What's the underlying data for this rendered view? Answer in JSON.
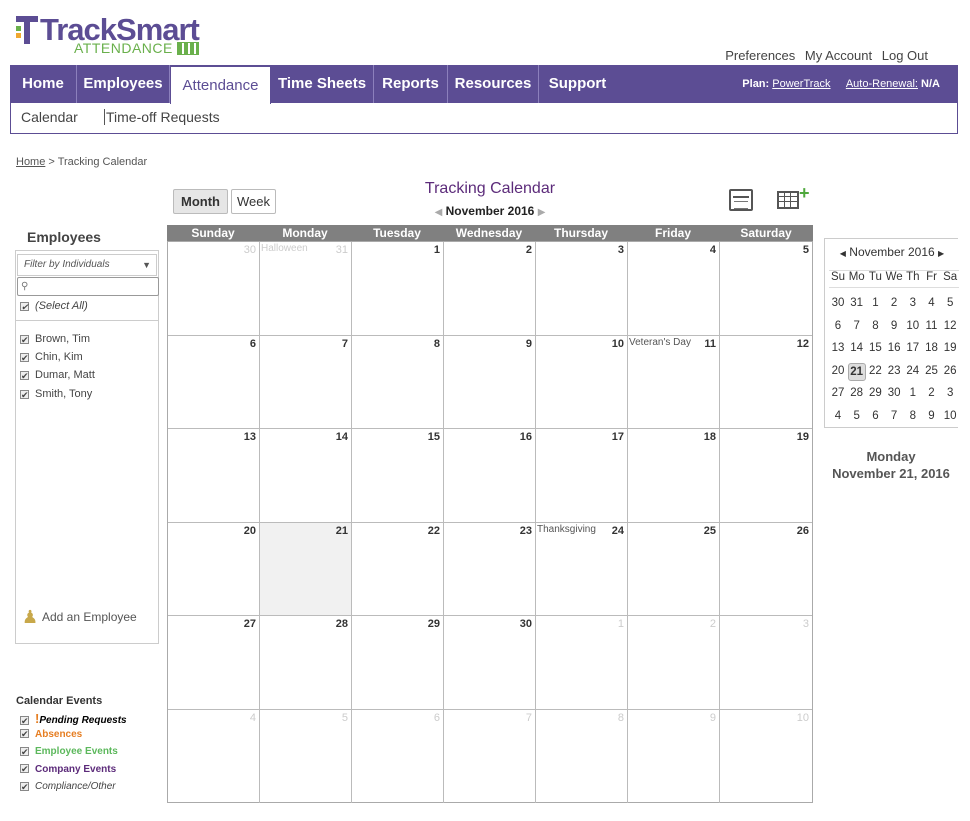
{
  "brand": {
    "name_main": "TrackSmart",
    "name_sub": "ATTENDANCE"
  },
  "toplinks": [
    "Preferences",
    "My Account",
    "Log Out"
  ],
  "nav": [
    "Home",
    "Employees",
    "Attendance",
    "Time Sheets",
    "Reports",
    "Resources",
    "Support"
  ],
  "plan": {
    "plan_label": "Plan:",
    "plan_value": "PowerTrack",
    "renewal_label": "Auto-Renewal:",
    "renewal_value": "N/A"
  },
  "subnav": [
    "Calendar",
    "Time-off Requests"
  ],
  "breadcrumb": {
    "home": "Home",
    "sep": " > ",
    "current": "Tracking Calendar"
  },
  "view_buttons": {
    "month": "Month",
    "week": "Week"
  },
  "calendar": {
    "title": "Tracking Calendar",
    "month_label": "November 2016",
    "weekdays": [
      "Sunday",
      "Monday",
      "Tuesday",
      "Wednesday",
      "Thursday",
      "Friday",
      "Saturday"
    ],
    "weeks": [
      [
        {
          "d": "30",
          "other": true
        },
        {
          "d": "31",
          "other": true,
          "ev": "Halloween"
        },
        {
          "d": "1"
        },
        {
          "d": "2"
        },
        {
          "d": "3"
        },
        {
          "d": "4"
        },
        {
          "d": "5"
        }
      ],
      [
        {
          "d": "6"
        },
        {
          "d": "7"
        },
        {
          "d": "8"
        },
        {
          "d": "9"
        },
        {
          "d": "10"
        },
        {
          "d": "11",
          "ev": "Veteran's Day"
        },
        {
          "d": "12"
        }
      ],
      [
        {
          "d": "13"
        },
        {
          "d": "14"
        },
        {
          "d": "15"
        },
        {
          "d": "16"
        },
        {
          "d": "17"
        },
        {
          "d": "18"
        },
        {
          "d": "19"
        }
      ],
      [
        {
          "d": "20"
        },
        {
          "d": "21",
          "today": true
        },
        {
          "d": "22"
        },
        {
          "d": "23"
        },
        {
          "d": "24",
          "ev": "Thanksgiving"
        },
        {
          "d": "25"
        },
        {
          "d": "26"
        }
      ],
      [
        {
          "d": "27"
        },
        {
          "d": "28"
        },
        {
          "d": "29"
        },
        {
          "d": "30"
        },
        {
          "d": "1",
          "other": true
        },
        {
          "d": "2",
          "other": true
        },
        {
          "d": "3",
          "other": true
        }
      ],
      [
        {
          "d": "4",
          "other": true
        },
        {
          "d": "5",
          "other": true
        },
        {
          "d": "6",
          "other": true
        },
        {
          "d": "7",
          "other": true
        },
        {
          "d": "8",
          "other": true
        },
        {
          "d": "9",
          "other": true
        },
        {
          "d": "10",
          "other": true
        }
      ]
    ]
  },
  "employees": {
    "title": "Employees",
    "filter": "Filter by Individuals",
    "select_all": "(Select All)",
    "list": [
      "Brown, Tim",
      "Chin, Kim",
      "Dumar, Matt",
      "Smith, Tony"
    ],
    "add": "Add an Employee"
  },
  "calendar_events": {
    "title": "Calendar Events",
    "items": [
      {
        "label": "Pending Requests",
        "color": "#000000",
        "style": "italic-bold",
        "prefix": "!"
      },
      {
        "label": "Absences",
        "color": "#e67e22",
        "style": "bold",
        "prefix": ""
      },
      {
        "label": "Employee Events",
        "color": "#5cb85c",
        "style": "bold",
        "prefix": ""
      },
      {
        "label": "Company Events",
        "color": "#5c2b7a",
        "style": "bold",
        "prefix": ""
      },
      {
        "label": "Compliance/Other",
        "color": "#444444",
        "style": "italic",
        "prefix": ""
      }
    ]
  },
  "mini_calendar": {
    "month_label": "November 2016",
    "dow": [
      "Su",
      "Mo",
      "Tu",
      "We",
      "Th",
      "Fr",
      "Sa"
    ],
    "rows": [
      [
        "30",
        "31",
        "1",
        "2",
        "3",
        "4",
        "5"
      ],
      [
        "6",
        "7",
        "8",
        "9",
        "10",
        "11",
        "12"
      ],
      [
        "13",
        "14",
        "15",
        "16",
        "17",
        "18",
        "19"
      ],
      [
        "20",
        "21",
        "22",
        "23",
        "24",
        "25",
        "26"
      ],
      [
        "27",
        "28",
        "29",
        "30",
        "1",
        "2",
        "3"
      ],
      [
        "4",
        "5",
        "6",
        "7",
        "8",
        "9",
        "10"
      ]
    ],
    "selected": "21"
  },
  "selected_date": {
    "weekday": "Monday",
    "date": "November 21, 2016"
  }
}
